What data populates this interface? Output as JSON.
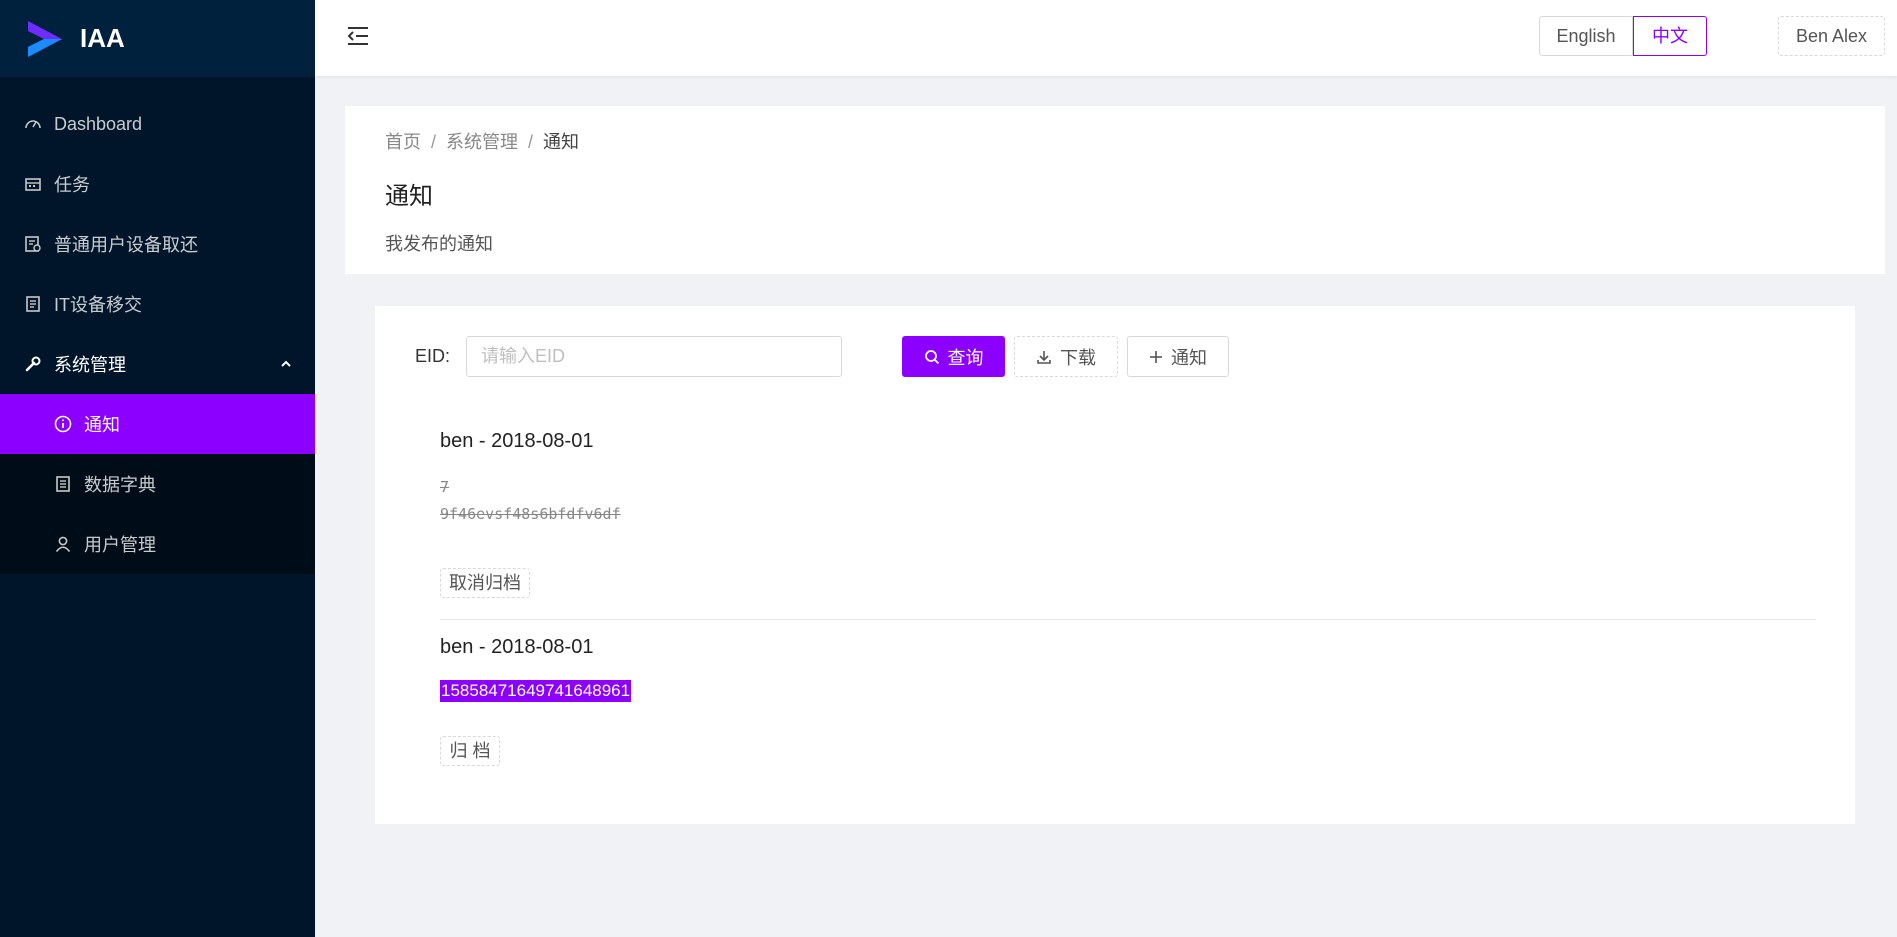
{
  "app": {
    "logo_text": "IAA"
  },
  "sidebar": {
    "items": [
      {
        "label": "Dashboard",
        "icon": "dashboard-icon"
      },
      {
        "label": "任务",
        "icon": "calendar-icon"
      },
      {
        "label": "普通用户设备取还",
        "icon": "form-icon"
      },
      {
        "label": "IT设备移交",
        "icon": "document-icon"
      },
      {
        "label": "系统管理",
        "icon": "wrench-icon",
        "expanded": true
      }
    ],
    "submenu": [
      {
        "label": "通知",
        "icon": "info-circle-icon",
        "active": true
      },
      {
        "label": "数据字典",
        "icon": "book-icon"
      },
      {
        "label": "用户管理",
        "icon": "user-icon"
      }
    ]
  },
  "header": {
    "lang_en": "English",
    "lang_zh": "中文",
    "user": "Ben Alex"
  },
  "page": {
    "breadcrumb": [
      "首页",
      "系统管理",
      "通知"
    ],
    "separator": "/",
    "title": "通知",
    "description": "我发布的通知"
  },
  "filter": {
    "eid_label": "EID:",
    "eid_placeholder": "请输入EID",
    "search_label": "查询",
    "download_label": "下载",
    "add_label": "通知"
  },
  "notices": [
    {
      "title": "ben - 2018-08-01",
      "lines": [
        "7",
        "9f46evsf48s6bfdfv6df"
      ],
      "action": "取消归档"
    },
    {
      "title": "ben - 2018-08-01",
      "selected_text": "15858471649741648961",
      "action": "归 档"
    }
  ],
  "colors": {
    "accent": "#8b00ff",
    "sidebar": "#001529",
    "submenu": "#000c17"
  }
}
